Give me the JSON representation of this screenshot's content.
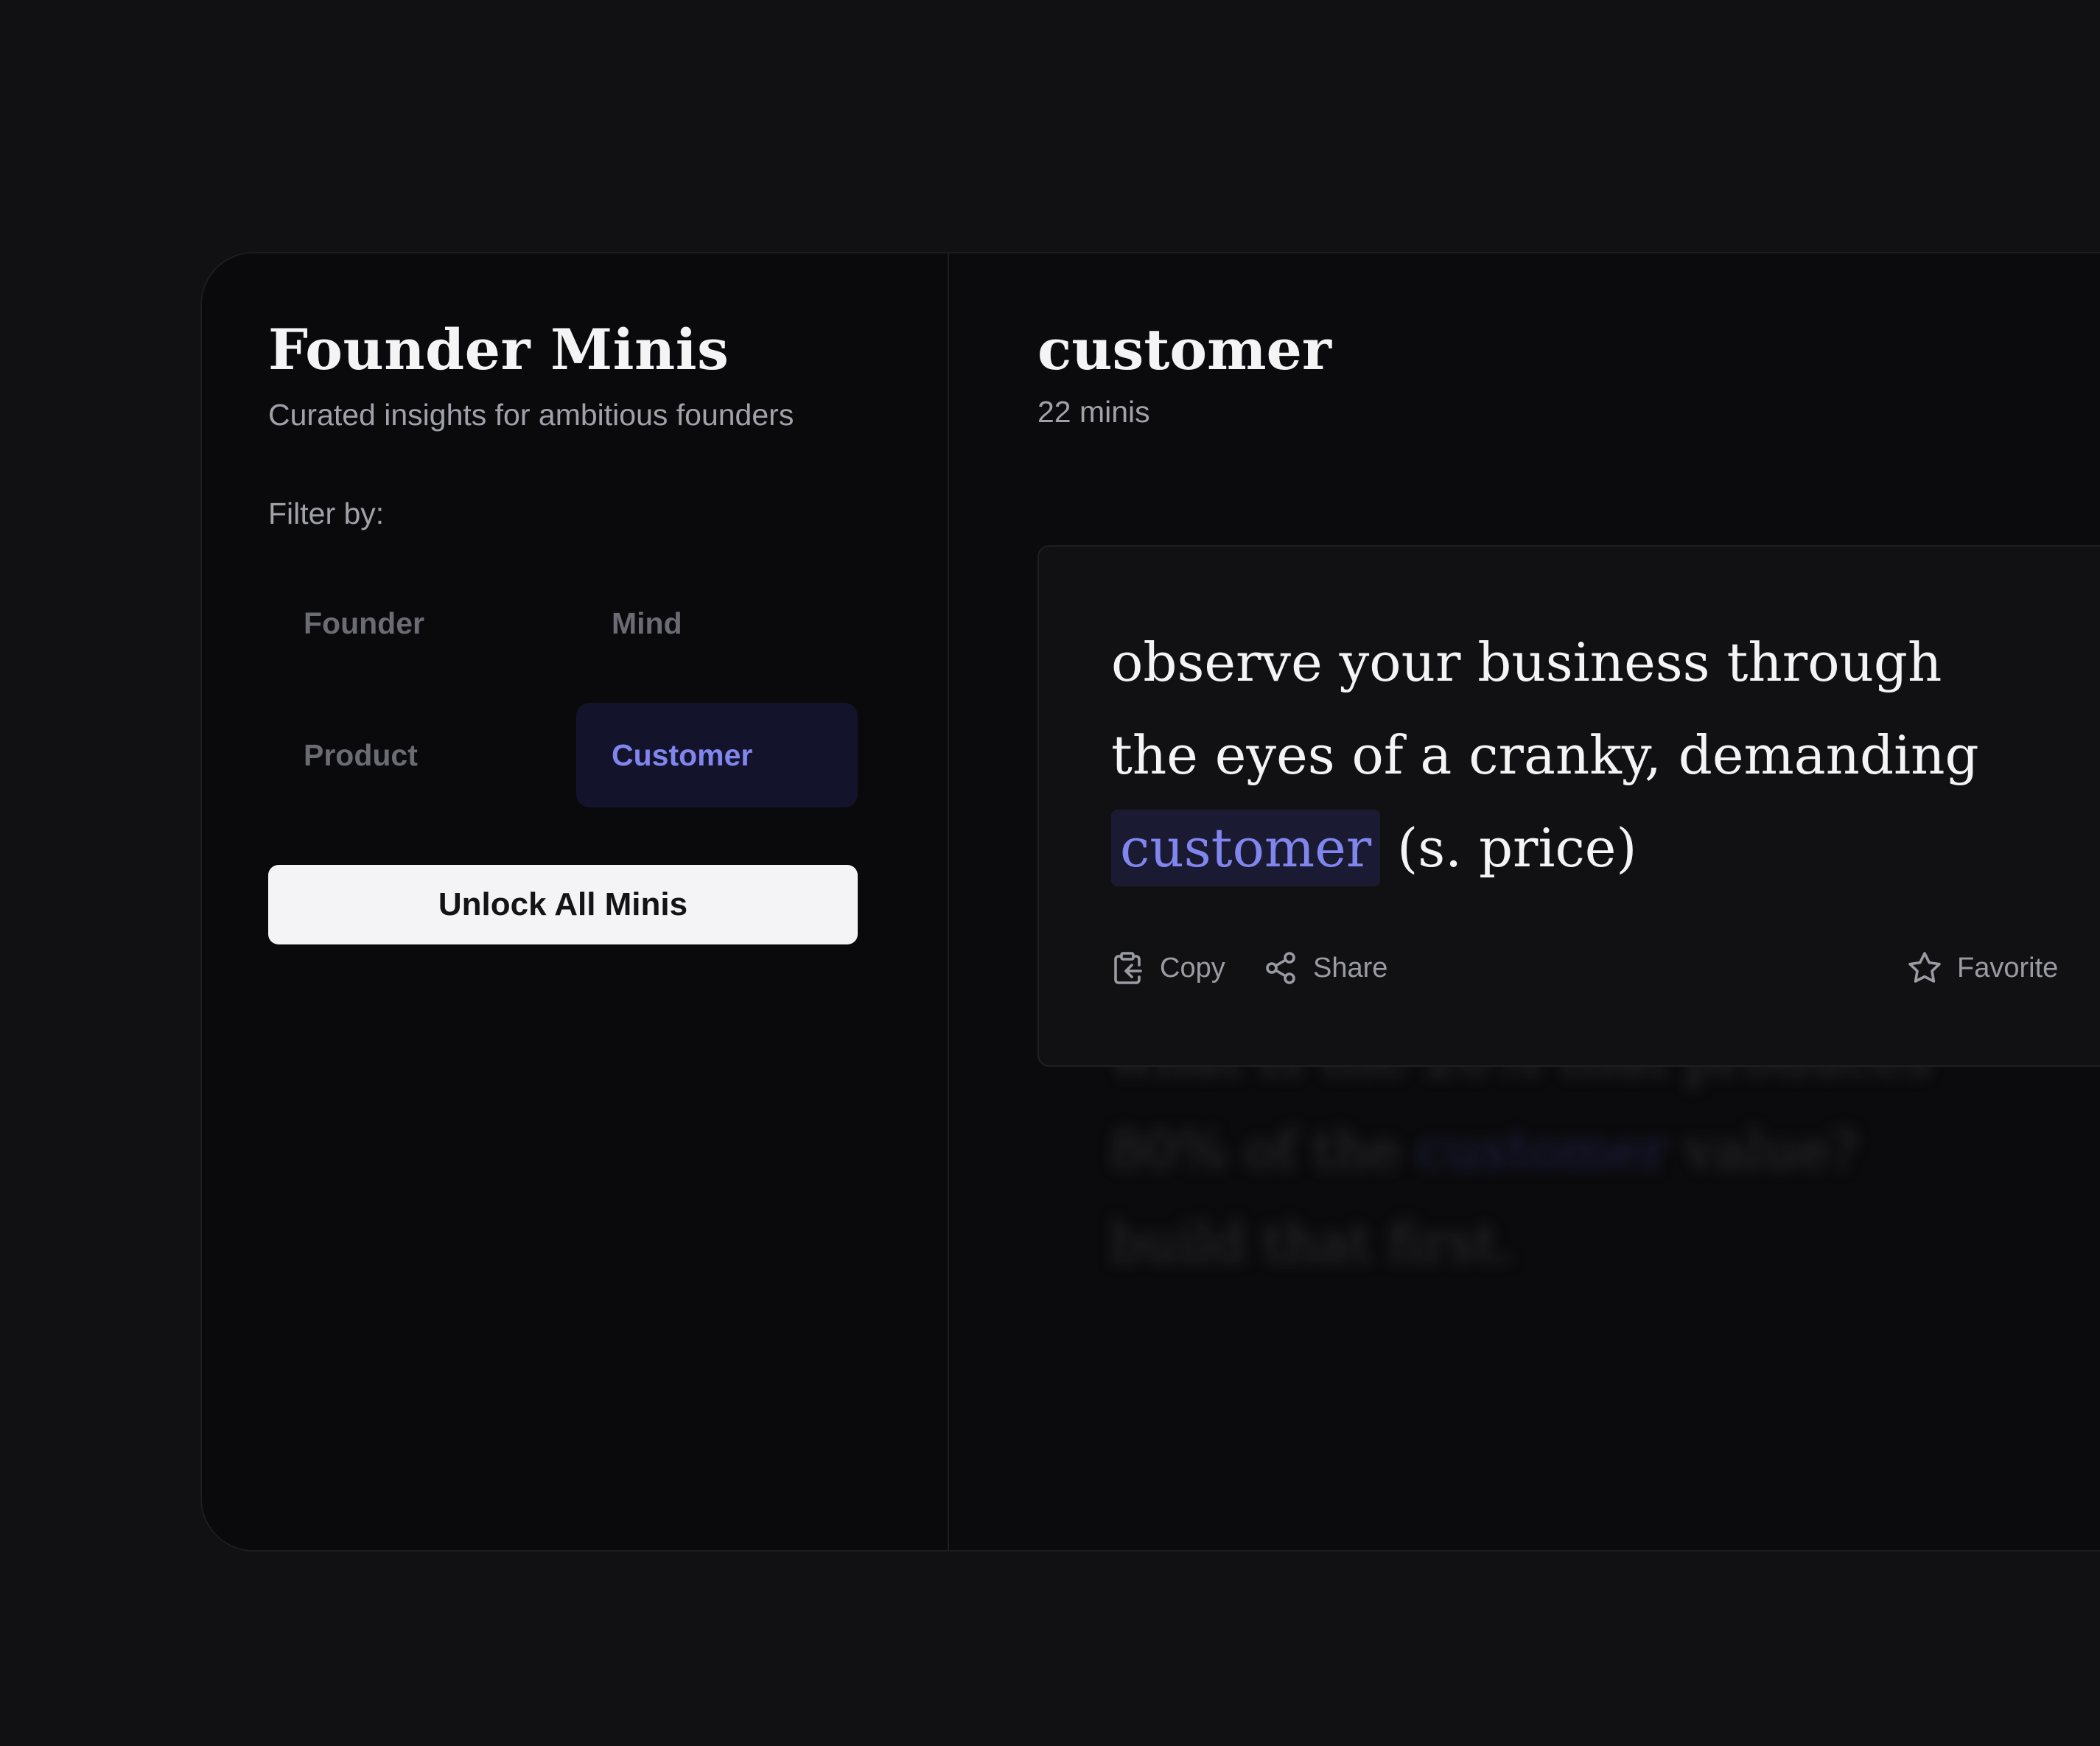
{
  "sidebar": {
    "title": "Founder Minis",
    "subtitle": "Curated insights for ambitious founders",
    "filter_label": "Filter by:",
    "filters": [
      {
        "label": "Founder",
        "active": false
      },
      {
        "label": "Mind",
        "active": false
      },
      {
        "label": "Product",
        "active": false
      },
      {
        "label": "Customer",
        "active": true
      }
    ],
    "unlock_label": "Unlock All Minis"
  },
  "main": {
    "category": "customer",
    "count": "22 minis",
    "card": {
      "line1": "observe your business through",
      "line2": "the eyes of a cranky, demanding",
      "highlight": "customer",
      "tail": "(s. price)",
      "actions": {
        "copy": "Copy",
        "share": "Share",
        "favorite": "Favorite"
      },
      "icons": {
        "copy": "clipboard-icon",
        "share": "share-icon",
        "favorite": "star-icon"
      }
    }
  },
  "colors": {
    "background": "#111113",
    "panel": "#0b0b0d",
    "accent": "#8186ee",
    "active_chip": "#13132b"
  }
}
